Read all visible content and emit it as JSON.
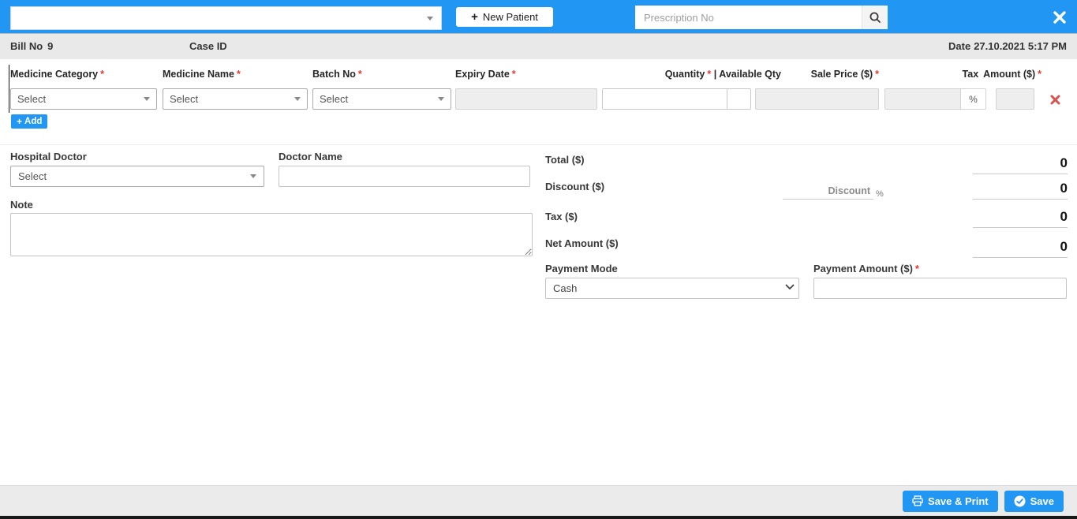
{
  "required_marker": "*",
  "colors": {
    "accent": "#2196f3",
    "required": "#e53935",
    "delete_x": "#d9534f",
    "topbar": "#2196f3"
  },
  "icons": {
    "plus": "+",
    "search": "magnifier",
    "close": "×",
    "chevron_down": "▾",
    "delete": "✖",
    "printer": "⎙",
    "check": "✔"
  },
  "topbar": {
    "patient_select_value": "",
    "new_patient_label": "New Patient",
    "prescription_placeholder": "Prescription No"
  },
  "infobar": {
    "bill_label": "Bill No",
    "bill_value": "9",
    "case_label": "Case ID",
    "date_label": "Date",
    "date_value": "27.10.2021 5:17 PM"
  },
  "table": {
    "headers": {
      "category": "Medicine Category",
      "name": "Medicine Name",
      "batch": "Batch No",
      "expiry": "Expiry Date",
      "quantity": "Quantity",
      "quantity_suffix": "| Available Qty",
      "sale_price": "Sale Price ($)",
      "tax": "Tax",
      "amount": "Amount ($)"
    },
    "row": {
      "category_value": "Select",
      "name_value": "Select",
      "batch_value": "Select",
      "percent": "%"
    },
    "add_label": "Add"
  },
  "form": {
    "hospital_doctor_label": "Hospital Doctor",
    "hospital_doctor_value": "Select",
    "doctor_name_label": "Doctor Name",
    "note_label": "Note"
  },
  "totals": {
    "total_label": "Total ($)",
    "total_value": "0",
    "discount_label": "Discount ($)",
    "discount_value": "0",
    "discount_placeholder": "Discount",
    "discount_percent": "%",
    "tax_label": "Tax ($)",
    "tax_value": "0",
    "net_label": "Net Amount ($)",
    "net_value": "0"
  },
  "payment": {
    "mode_label": "Payment Mode",
    "mode_value": "Cash",
    "amount_label": "Payment Amount ($)"
  },
  "footer": {
    "save_print_label": "Save & Print",
    "save_label": "Save"
  }
}
